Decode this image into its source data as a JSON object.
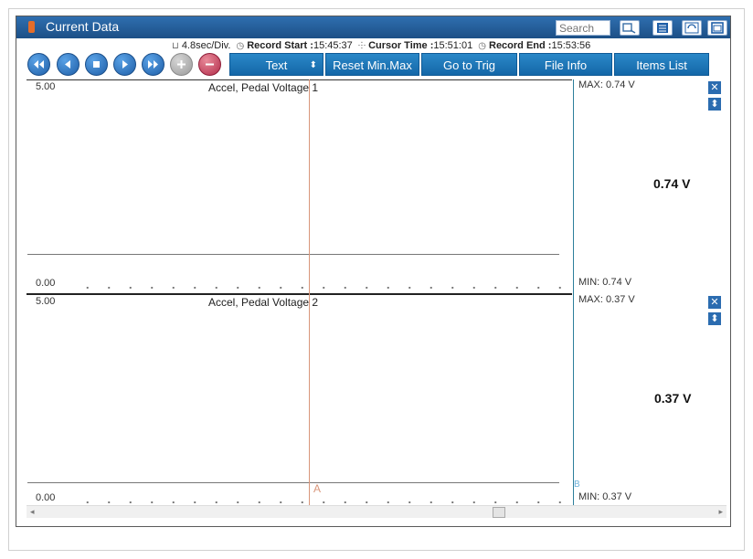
{
  "window": {
    "title": "Current Data"
  },
  "search": {
    "placeholder": "Search"
  },
  "info": {
    "time_div": "4.8sec/Div.",
    "record_start_label": "Record Start :",
    "record_start": "15:45:37",
    "cursor_time_label": "Cursor Time :",
    "cursor_time": "15:51:01",
    "record_end_label": "Record End :",
    "record_end": "15:53:56"
  },
  "toolbar": {
    "text_label": "Text",
    "reset_label": "Reset Min.Max",
    "trig_label": "Go to Trig",
    "file_info_label": "File Info",
    "items_list_label": "Items List",
    "text_select_glyph": "⬍"
  },
  "icons": {
    "rewind": "rewind-icon",
    "prev": "prev-icon",
    "stop": "stop-icon",
    "play": "play-icon",
    "fast_forward": "fast-forward-icon",
    "add": "add-icon",
    "remove": "remove-icon",
    "close": "close-icon",
    "resize": "resize-icon"
  },
  "colors": {
    "title_bar": "#1c4f86",
    "button_blue": "#1467a8",
    "cursor_a": "#d9967a",
    "cursor_b": "#2d7f9c"
  },
  "panels": [
    {
      "title": "Accel, Pedal Voltage 1",
      "ymax": "5.00",
      "ymin": "0.00",
      "max_text": "MAX:  0.74 V",
      "min_text": "MIN:  0.74 V",
      "value": "0.74 V"
    },
    {
      "title": "Accel, Pedal Voltage 2",
      "ymax": "5.00",
      "ymin": "0.00",
      "max_text": "MAX:  0.37 V",
      "min_text": "MIN:  0.37 V",
      "value": "0.37 V"
    }
  ],
  "cursors": {
    "a_label": "A",
    "b_label": "B"
  },
  "close_glyph": "✕",
  "resize_glyph": "⬍"
}
